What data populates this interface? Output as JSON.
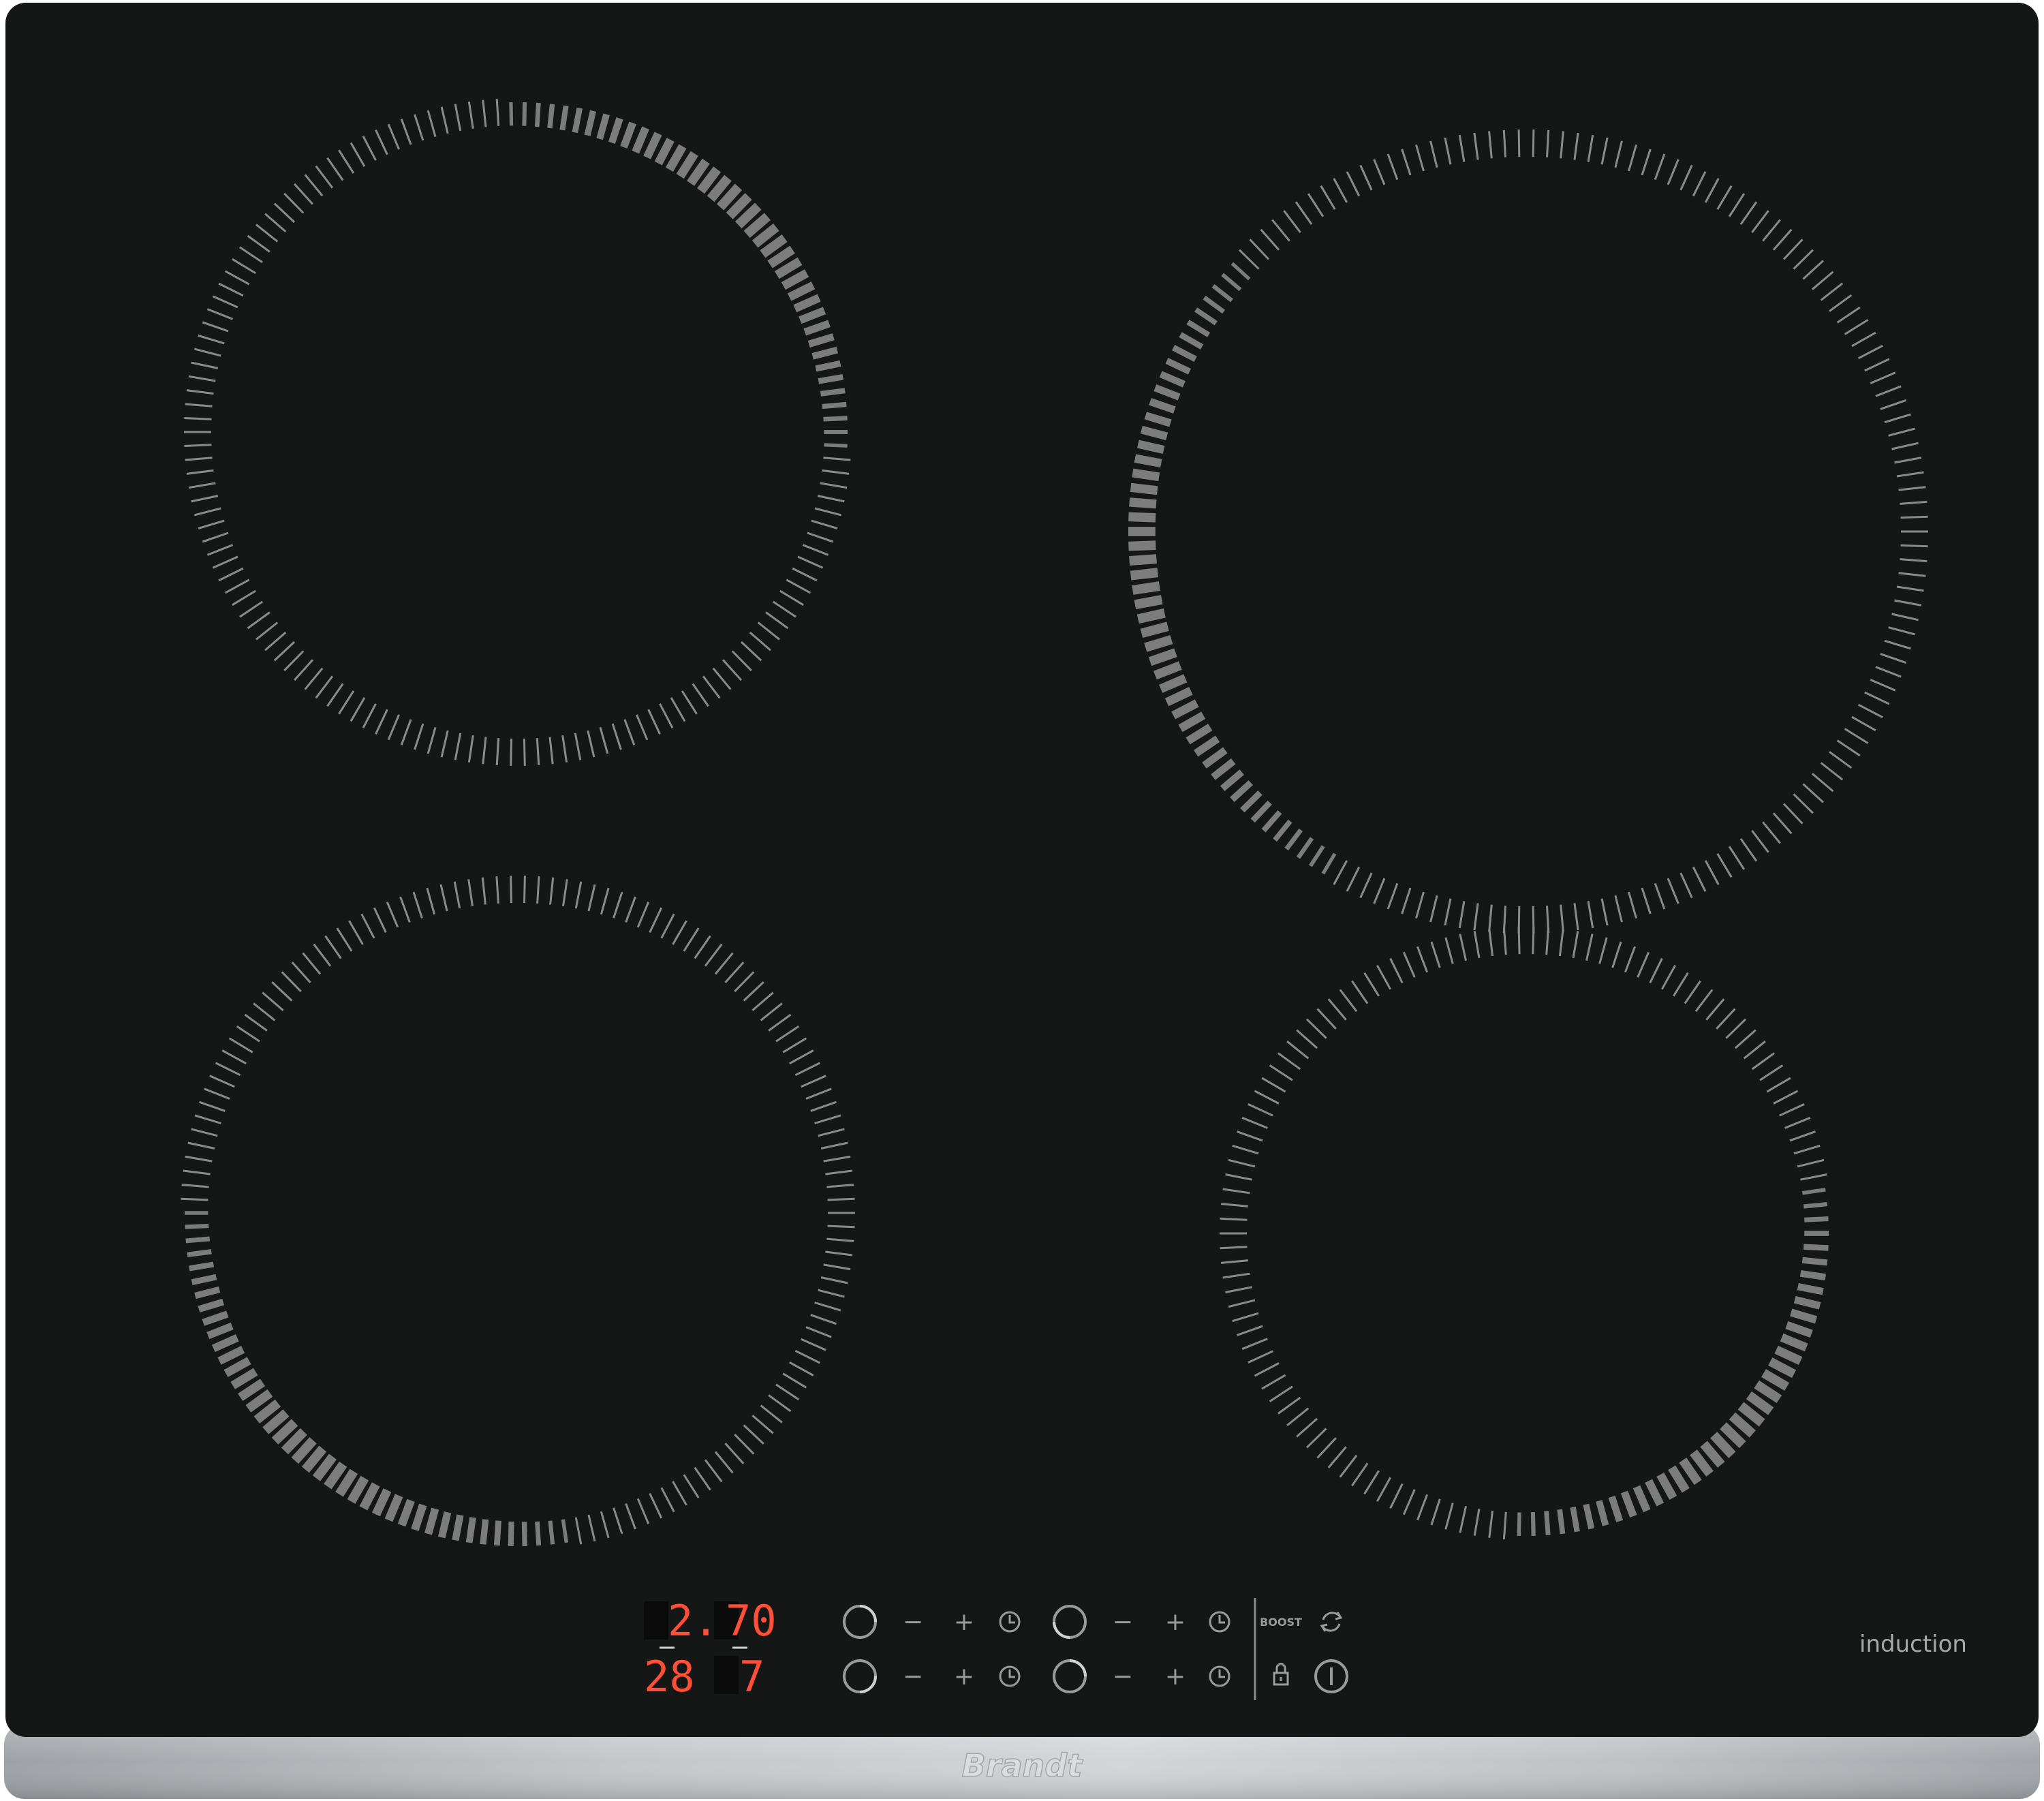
{
  "appliance": {
    "type_label": "induction",
    "brand_logo": "Brandt",
    "colors": {
      "glass": "#151716",
      "ring_marks": "#8a8a8a",
      "lit_marks": "#7c7c7c",
      "display_red": "#ff4f36",
      "steel": "#b9bcbf"
    }
  },
  "zones": [
    {
      "id": "rear-left",
      "lit_fraction": 0.3
    },
    {
      "id": "rear-right",
      "lit_fraction": 0.3
    },
    {
      "id": "front-left",
      "lit_fraction": 0.3
    },
    {
      "id": "front-right",
      "lit_fraction": 0.3
    }
  ],
  "displays": {
    "top_left_digit": "2.",
    "top_right_digits": "70",
    "bottom_left_digits": "28",
    "bottom_right_digit": "7"
  },
  "controls": {
    "boost_label": "BOOST",
    "minus_symbol": "−",
    "plus_symbol": "+"
  }
}
